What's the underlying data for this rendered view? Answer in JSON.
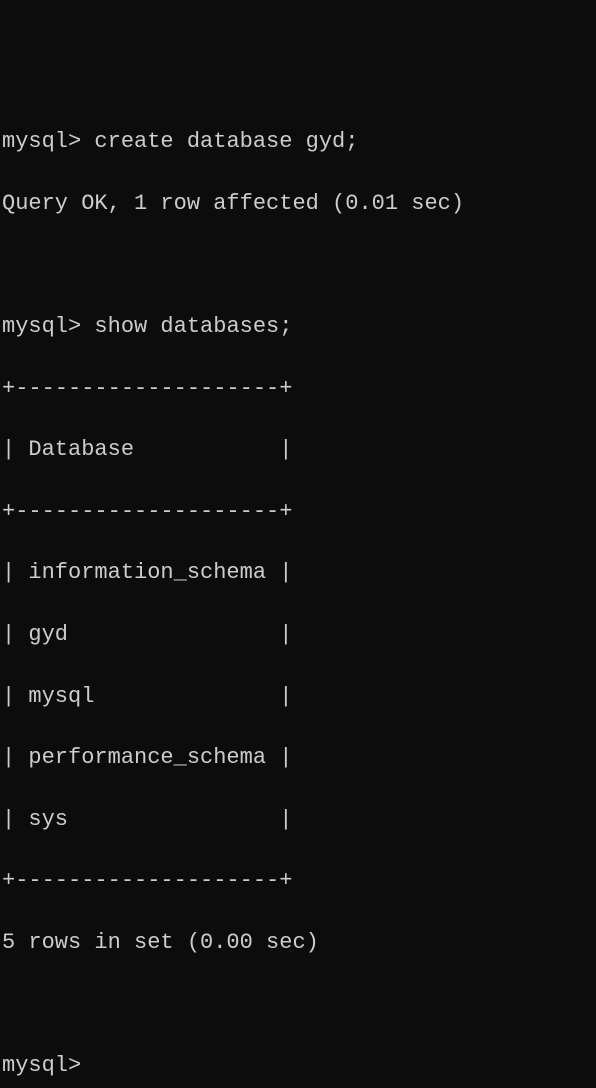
{
  "terminal": {
    "prompt": "mysql>",
    "cmd1": "create database gyd;",
    "result1": "Query OK, 1 row affected (0.01 sec)",
    "cmd2": "show databases;",
    "table": {
      "border_top": "+--------------------+",
      "header": "| Database           |",
      "border_mid": "+--------------------+",
      "rows": [
        "| information_schema |",
        "| gyd                |",
        "| mysql              |",
        "| performance_schema |",
        "| sys                |"
      ],
      "border_bot": "+--------------------+"
    },
    "result2": "5 rows in set (0.00 sec)",
    "prompt_final": "mysql>"
  }
}
